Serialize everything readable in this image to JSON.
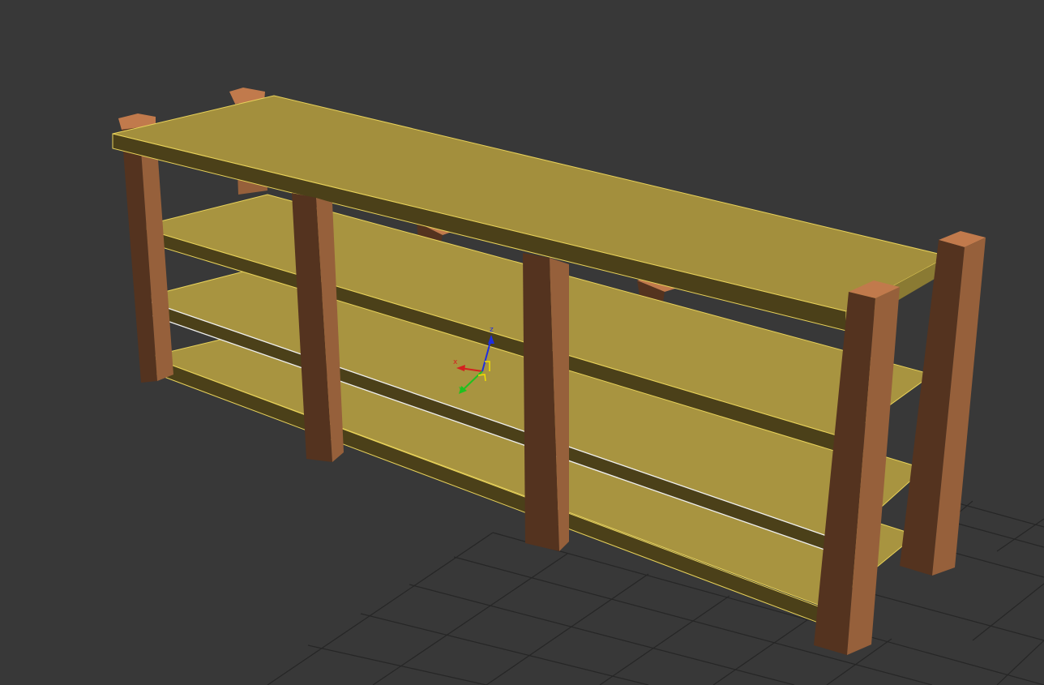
{
  "viewport": {
    "background": "#383838",
    "grid_color": "#252525",
    "selection_color": "#f0f0f0"
  },
  "model": {
    "shelf_top_color": "#a38f3d",
    "shelf_front_color": "#4b4019",
    "shelf_lower_top_color": "#a89440",
    "shelf_edge_highlight": "#e8d25a",
    "post_side_color": "#96603b",
    "post_front_color": "#54331f",
    "post_cap_color": "#c17a4c"
  },
  "gizmo": {
    "x_label": "x",
    "y_label": "y",
    "z_label": "z",
    "x_color": "#d42020",
    "y_color": "#1fc21f",
    "z_color": "#1e2ee0",
    "plane_color": "#f0e000"
  }
}
